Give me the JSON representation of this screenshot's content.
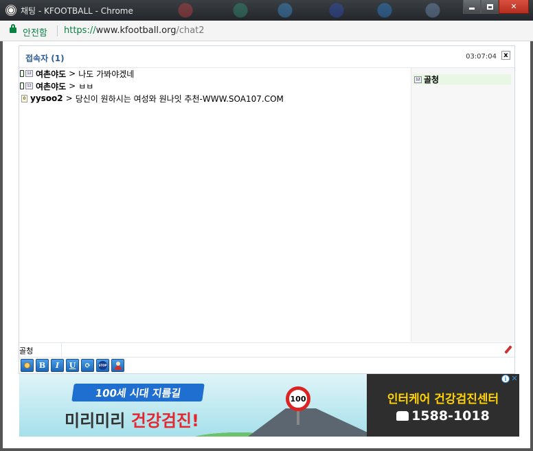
{
  "window": {
    "title": "채팅 - KFOOTBALL - Chrome",
    "app_icon": "soccer-ball-icon"
  },
  "address_bar": {
    "secure_label": "안전함",
    "url_scheme": "https://",
    "url_host": "www.kfootball.org",
    "url_path": "/chat2"
  },
  "chat": {
    "users_label": "접속자 (1)",
    "clock": "03:07:04",
    "close_label": "x",
    "messages": [
      {
        "nick": "여촌야도",
        "arrow": ">",
        "text": "나도 가봐야겠네",
        "device": "mobile"
      },
      {
        "nick": "여촌야도",
        "arrow": ">",
        "text": "ㅂㅂ",
        "device": "mobile"
      },
      {
        "nick": "yysoo2",
        "arrow": ">",
        "text": "당신이 원하시는 여성와 원나잇 추천-WWW.SOA107.COM",
        "device": "guest"
      }
    ],
    "users": [
      {
        "name": "골청"
      }
    ],
    "nickname": "골청",
    "input_value": "",
    "toolbar": [
      {
        "name": "emoticon-button",
        "label": ""
      },
      {
        "name": "bold-button",
        "label": "B"
      },
      {
        "name": "italic-button",
        "label": "I"
      },
      {
        "name": "underline-button",
        "label": "U"
      },
      {
        "name": "refresh-button",
        "label": ""
      },
      {
        "name": "stop-button",
        "label": "STOP"
      },
      {
        "name": "profile-button",
        "label": ""
      }
    ]
  },
  "ad": {
    "ribbon": "100세 시대 지름길",
    "headline_a": "미리미리 ",
    "headline_b": "건강검진!",
    "sign": "100",
    "company": "인터케어 건강검진센터",
    "phone": "1588-1018",
    "info": "i",
    "close": "✕"
  },
  "colors": {
    "secure_green": "#0b8043",
    "users_label_blue": "#2d5d96",
    "toolbar_blue": "#1c66b8",
    "ad_yellow": "#ffd200",
    "ad_red": "#e3262f"
  }
}
